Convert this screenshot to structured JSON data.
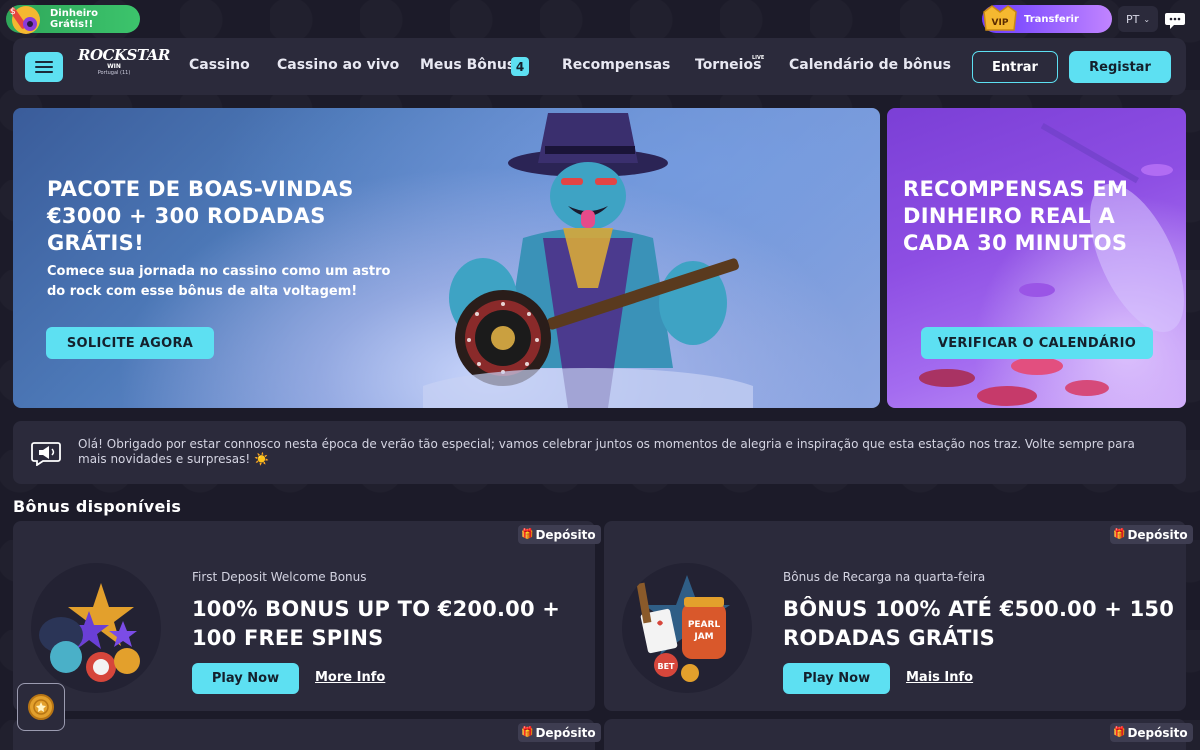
{
  "topbar": {
    "promo_label": "Dinheiro Grátis!!",
    "vip_label": "Transferir",
    "vip_badge": "VIP",
    "language": "PT"
  },
  "nav": {
    "logo_line1": "ROCKSTAR",
    "logo_line2": "WIN",
    "logo_line3": "Portugal (11)",
    "items": [
      {
        "label": "Cassino"
      },
      {
        "label": "Cassino ao vivo"
      },
      {
        "label": "Meus Bônus"
      },
      {
        "label": "Recompensas"
      },
      {
        "label": "Torneios"
      },
      {
        "label": "Calendário de bônus"
      }
    ],
    "bonus_count": "4",
    "live_tag": "LIVE",
    "login_label": "Entrar",
    "register_label": "Registar"
  },
  "hero": {
    "main_title": "PACOTE DE BOAS-VINDAS €3000 + 300 RODADAS GRÁTIS!",
    "main_subtitle": "Comece sua jornada no cassino como um astro do rock com esse bônus de alta voltagem!",
    "main_button": "SOLICITE AGORA",
    "side_title": "RECOMPENSAS EM DINHEIRO REAL A CADA 30 MINUTOS",
    "side_button": "VERIFICAR O CALENDÁRIO"
  },
  "notice": {
    "text": "Olá! Obrigado por estar connosco nesta época de verão tão especial; vamos celebrar juntos os momentos de alegria e inspiração que esta estação nos traz. Volte sempre para mais novidades e surpresas! ☀️"
  },
  "bonuses": {
    "section_title": "Bônus disponíveis",
    "cards": [
      {
        "tag": "Depósito",
        "label": "First Deposit Welcome Bonus",
        "heading": "100% BONUS UP TO €200.00 + 100 FREE SPINS",
        "play_label": "Play Now",
        "info_label": "More Info"
      },
      {
        "tag": "Depósito",
        "label": "Bônus de Recarga na quarta-feira",
        "heading": "BÔNUS 100% ATÉ €500.00 + 150 RODADAS GRÁTIS",
        "play_label": "Play Now",
        "info_label": "Mais Info"
      },
      {
        "tag": "Depósito"
      },
      {
        "tag": "Depósito"
      }
    ]
  },
  "colors": {
    "accent": "#5de0f2",
    "background": "#1c1b29",
    "panel": "#2b2a3b",
    "promo_green": "#3cc46c",
    "vip_purple": "#8a5cff"
  },
  "icons": [
    "guitar-promo-icon",
    "vip-crown-icon",
    "chevron-down-icon",
    "chat-icon",
    "menu-icon",
    "megaphone-icon",
    "gift-icon",
    "coin-icon"
  ]
}
